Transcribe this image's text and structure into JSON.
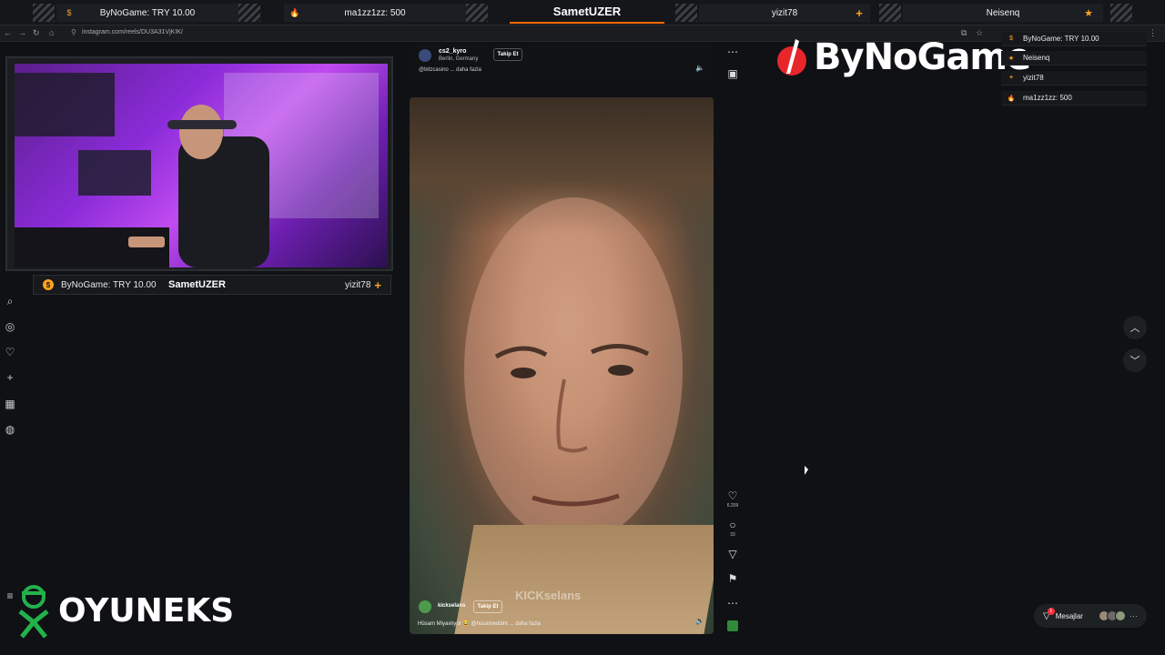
{
  "topbar": {
    "donation": "ByNoGame: TRY 10.00",
    "donor2": "ma1zz1zz: 500",
    "streamer": "SametUZER",
    "follower": "yizit78",
    "sub": "Neisenq",
    "icons": {
      "donation": "dollar-coin-icon",
      "fire": "flame-icon",
      "plus": "plus-icon",
      "star": "star-icon"
    },
    "accent": "#ff6a00"
  },
  "browser": {
    "url": "instagram.com/reels/DU3A31VjKIK/"
  },
  "webcam": {
    "bar_left": "ByNoGame: TRY 10.00",
    "bar_center": "SametUZER",
    "bar_right": "yizit78"
  },
  "reel_top": {
    "username": "cs2_kyro",
    "location": "Berlin, Germany",
    "follow": "Takip Et",
    "caption": "@bitzcasino ... daha fazla"
  },
  "reel": {
    "watermark": "KICKselans",
    "username": "kickselans",
    "follow": "Takip Et",
    "caption": "Hüsam Miyavlıyor 😂 @husameddint ... daha fazla",
    "likes": "6.209",
    "comments": "33"
  },
  "right": {
    "brand": "ByNoGame",
    "brand_color": "#e8262a",
    "events": [
      {
        "icon": "dollar-coin-icon",
        "text": "ByNoGame: TRY 10.00"
      },
      {
        "icon": "star-icon",
        "text": "Neisenq"
      },
      {
        "icon": "plus-icon",
        "text": "yizit78"
      },
      {
        "icon": "flame-icon",
        "text": "ma1zz1zz: 500"
      }
    ],
    "messages_label": "Mesajlar",
    "messages_badge": "1"
  },
  "oyuneks": {
    "text": "OYUNEKS",
    "color": "#22b24c"
  }
}
